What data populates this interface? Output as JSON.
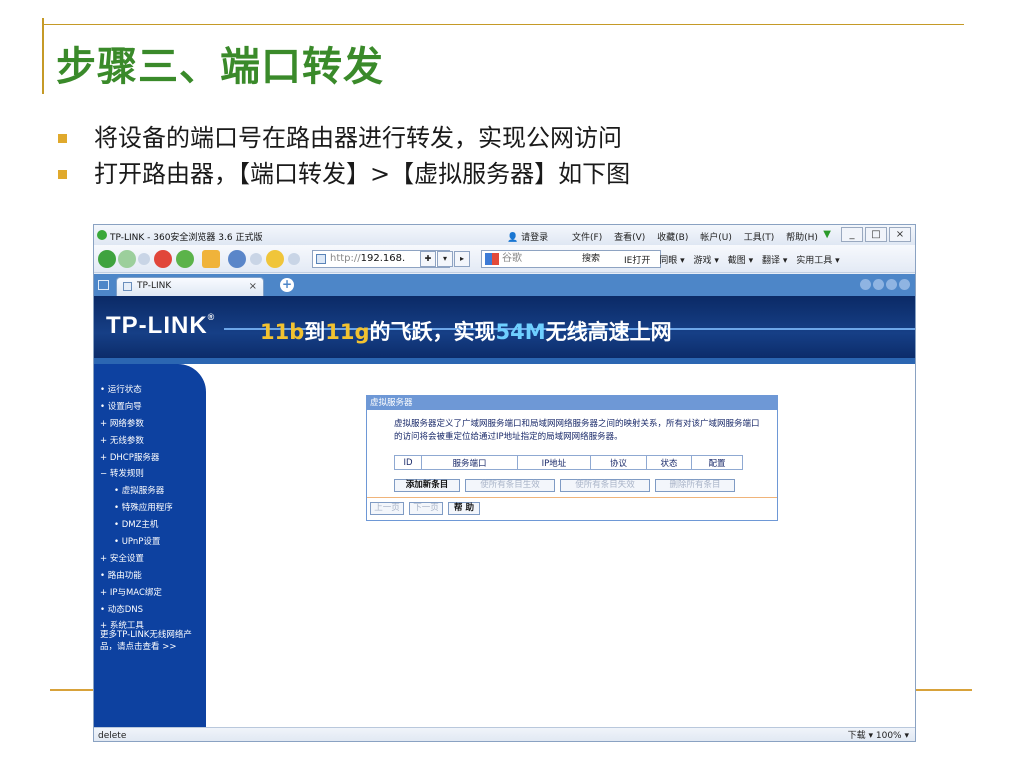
{
  "slide": {
    "title": "步骤三、端口转发",
    "bullets": [
      "将设备的端口号在路由器进行转发，实现公网访问",
      "打开路由器，【端口转发】>【虚拟服务器】如下图"
    ]
  },
  "browser": {
    "title": "TP-LINK - 360安全浏览器 3.6 正式版",
    "login": "请登录",
    "menus": [
      "文件(F)",
      "查看(V)",
      "收藏(B)",
      "帐户(U)",
      "工具(T)",
      "帮助(H)"
    ],
    "window_buttons": [
      "_",
      "□",
      "×"
    ],
    "address_protocol": "http://",
    "address_host": "192.168.",
    "search_placeholder": "谷歌",
    "search_button": "搜索",
    "toolbar_links": [
      "IE打开",
      "同眼 ▾",
      "游戏 ▾",
      "截图 ▾",
      "翻译 ▾",
      "实用工具 ▾"
    ],
    "tab_label": "TP-LINK",
    "tab_close": "×",
    "tab_new": "+",
    "status_text": "delete",
    "status_right": "下载 ▾   100% ▾"
  },
  "router": {
    "logo": "TP-LINK",
    "logo_mark": "®",
    "slogan": {
      "p1": "11b",
      "p2": "到",
      "p3": "11g",
      "p4": "的飞跃，实现",
      "p5": "54M",
      "p6": "无线高速上网"
    },
    "sidebar_items": [
      {
        "label": "• 运行状态",
        "sub": false
      },
      {
        "label": "• 设置向导",
        "sub": false
      },
      {
        "label": "+ 网络参数",
        "sub": false
      },
      {
        "label": "+ 无线参数",
        "sub": false
      },
      {
        "label": "+ DHCP服务器",
        "sub": false
      },
      {
        "label": "− 转发规则",
        "sub": false
      },
      {
        "label": "• 虚拟服务器",
        "sub": true
      },
      {
        "label": "• 特殊应用程序",
        "sub": true
      },
      {
        "label": "• DMZ主机",
        "sub": true
      },
      {
        "label": "• UPnP设置",
        "sub": true
      },
      {
        "label": "+ 安全设置",
        "sub": false
      },
      {
        "label": "• 路由功能",
        "sub": false
      },
      {
        "label": "+ IP与MAC绑定",
        "sub": false
      },
      {
        "label": "• 动态DNS",
        "sub": false
      },
      {
        "label": "+ 系统工具",
        "sub": false
      }
    ],
    "sidebar_more": "更多TP-LINK无线网络产品，请点击查看 >>",
    "panel": {
      "title": "虚拟服务器",
      "description": "虚拟服务器定义了广域网服务端口和局域网网络服务器之间的映射关系，所有对该广域网服务端口的访问将会被重定位给通过IP地址指定的局域网网络服务器。",
      "columns": [
        "ID",
        "服务端口",
        "IP地址",
        "协议",
        "状态",
        "配置"
      ],
      "buttons": {
        "add": "添加新条目",
        "enable_all": "使所有条目生效",
        "disable_all": "使所有条目失效",
        "delete_all": "删除所有条目",
        "prev": "上一页",
        "next": "下一页",
        "help": "帮 助"
      }
    }
  }
}
